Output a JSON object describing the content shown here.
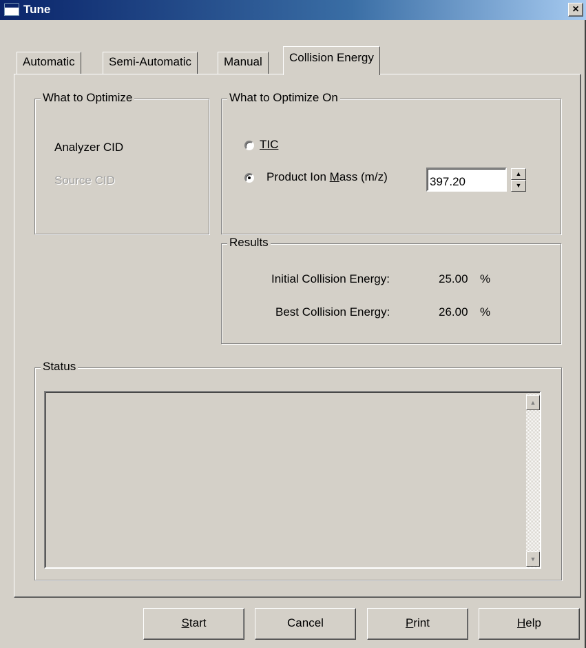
{
  "window": {
    "title": "Tune",
    "close_glyph": "×"
  },
  "tabs": [
    {
      "label": "Automatic",
      "active": false
    },
    {
      "label": "Semi-Automatic",
      "active": false
    },
    {
      "label": "Manual",
      "active": false
    },
    {
      "label": "Collision Energy",
      "active": true
    }
  ],
  "what_to_optimize": {
    "legend": "What to Optimize",
    "analyzer_cid": "Analyzer CID",
    "source_cid": "Source CID"
  },
  "what_to_optimize_on": {
    "legend": "What to Optimize On",
    "tic_label": "TIC",
    "tic_mnemonic": "T",
    "product_ion_label_pre": "Product Ion ",
    "product_ion_mnemonic": "M",
    "product_ion_label_post": "ass (m/z)",
    "selected": "product_ion_mass",
    "mass_value": "397.20"
  },
  "results": {
    "legend": "Results",
    "initial_label": "Initial Collision Energy:",
    "initial_value": "25.00",
    "best_label": "Best Collision Energy:",
    "best_value": "26.00",
    "unit": "%"
  },
  "status": {
    "legend": "Status",
    "text": ""
  },
  "buttons": {
    "start": {
      "mnemonic": "S",
      "rest": "tart"
    },
    "cancel": "Cancel",
    "print": {
      "mnemonic": "P",
      "rest": "rint"
    },
    "help": {
      "mnemonic": "H",
      "rest": "elp"
    }
  },
  "icons": {
    "window_icon": "window-icon",
    "spin_up": "▲",
    "spin_down": "▼",
    "scroll_up": "▲",
    "scroll_down": "▼"
  },
  "colors": {
    "title_gradient_start": "#0a246a",
    "title_gradient_end": "#a6caf0",
    "face": "#d4d0c8"
  }
}
